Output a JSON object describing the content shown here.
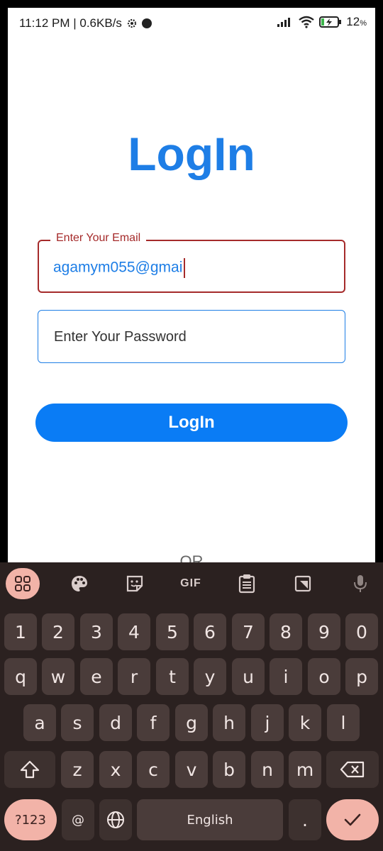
{
  "status_bar": {
    "time_info": "11:12 PM | 0.6KB/s",
    "battery": "12",
    "battery_unit": "%"
  },
  "page": {
    "title": "LogIn",
    "email_label": "Enter Your Email",
    "email_value": "agamym055@gmai",
    "password_placeholder": "Enter Your Password",
    "login_button": "LogIn",
    "or_text": "OR"
  },
  "keyboard": {
    "toolbar": [
      "apps-icon",
      "palette-icon",
      "sticker-icon",
      "gif",
      "clipboard-icon",
      "screenshot-icon",
      "mic-icon"
    ],
    "gif_label": "GIF",
    "number_row": [
      "1",
      "2",
      "3",
      "4",
      "5",
      "6",
      "7",
      "8",
      "9",
      "0"
    ],
    "row1": [
      "q",
      "w",
      "e",
      "r",
      "t",
      "y",
      "u",
      "i",
      "o",
      "p"
    ],
    "row2": [
      "a",
      "s",
      "d",
      "f",
      "g",
      "h",
      "j",
      "k",
      "l"
    ],
    "row3": [
      "z",
      "x",
      "c",
      "v",
      "b",
      "n",
      "m"
    ],
    "symbols_key": "?123",
    "at_key": "@",
    "space_label": "English",
    "period_key": ".",
    "colors": {
      "accent": "#f2b3a8",
      "key": "#4a3c3a",
      "background": "#2b2120"
    }
  }
}
